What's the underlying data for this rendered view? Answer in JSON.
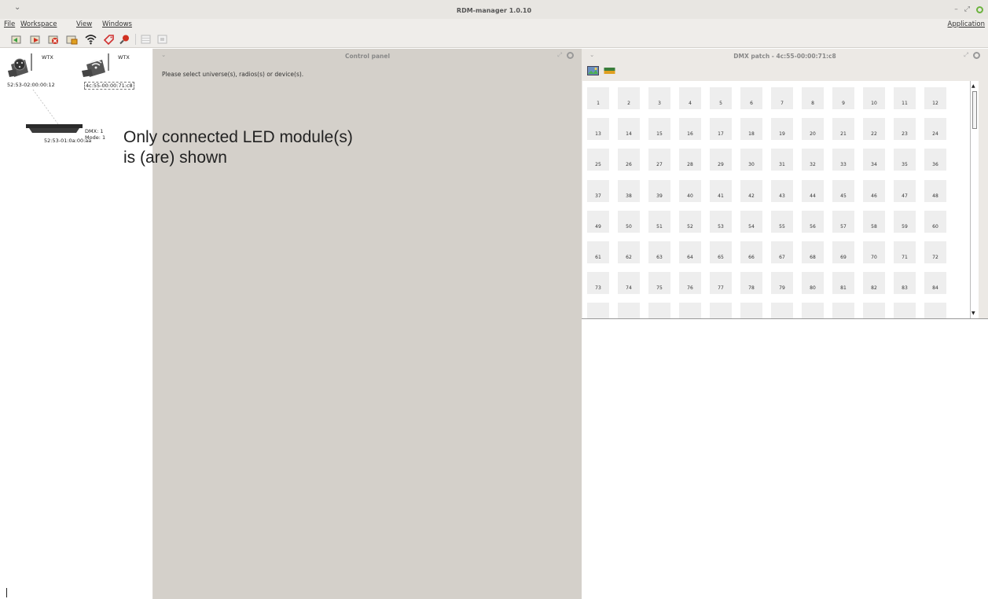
{
  "window": {
    "title": "RDM-manager 1.0.10"
  },
  "menu": {
    "file": "File",
    "workspace": "Workspace",
    "view": "View",
    "windows": "Windows",
    "application": "Application"
  },
  "toolbar": {
    "icons": [
      "device-add-icon",
      "device-next-icon",
      "device-remove-icon",
      "device-folder-icon",
      "wifi-icon",
      "tag-icon",
      "search-icon",
      "grid-disabled-icon",
      "panel-disabled-icon"
    ]
  },
  "tree": {
    "nodes": [
      {
        "tag": "WTX",
        "label": "52:53-02:00:00:12",
        "icon": "dmx-connector-icon"
      },
      {
        "tag": "WTX",
        "label": "4c:55-00:00:71:c8",
        "icon": "wireless-transmitter-icon"
      }
    ],
    "device": {
      "dmx": "DMX: 1",
      "mode": "Mode: 1",
      "label": "52:53-01:0a:00:aa",
      "icon": "led-bar-icon"
    }
  },
  "control_panel": {
    "title": "Control panel",
    "message": "Please select universe(s), radios(s) or device(s)."
  },
  "dmx_patch": {
    "title": "DMX patch - 4c:55-00:00:71:c8",
    "icons": [
      "patch-image-icon",
      "patch-bar-icon"
    ]
  },
  "overlay": {
    "line1": "Only connected LED module(s)",
    "line2": "is (are) shown"
  }
}
